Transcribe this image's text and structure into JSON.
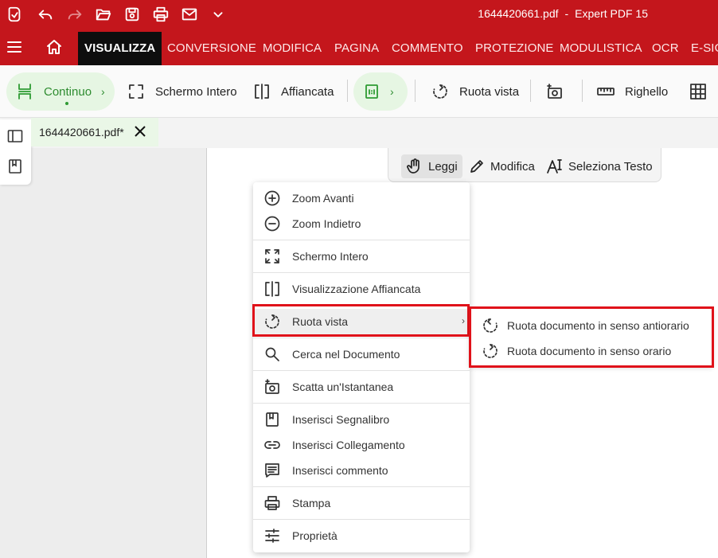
{
  "app": {
    "file_name": "1644420661.pdf",
    "separator": "-",
    "app_name": "Expert PDF 15"
  },
  "quick_access": [
    "app-logo-icon",
    "undo-icon",
    "redo-icon",
    "open-folder-icon",
    "save-icon",
    "print-icon",
    "mail-icon",
    "chevron-down-icon"
  ],
  "ribbon": {
    "tabs": [
      "VISUALIZZA",
      "CONVERSIONE",
      "MODIFICA",
      "PAGINA",
      "COMMENTO",
      "PROTEZIONE",
      "MODULISTICA",
      "OCR",
      "E-SIG"
    ]
  },
  "toolbar": {
    "continuo": "Continuo",
    "schermo_intero": "Schermo Intero",
    "affiancata": "Affiancata",
    "ruota_vista": "Ruota vista",
    "righello": "Righello",
    "chevron": "›"
  },
  "document_tab": {
    "name": "1644420661.pdf*"
  },
  "mode_bar": {
    "leggi": "Leggi",
    "modifica": "Modifica",
    "seleziona_testo": "Seleziona Testo"
  },
  "context_menu": {
    "zoom_avanti": "Zoom Avanti",
    "zoom_indietro": "Zoom Indietro",
    "schermo_intero": "Schermo Intero",
    "visualizzazione_affiancata": "Visualizzazione Affiancata",
    "ruota_vista": "Ruota vista",
    "cerca": "Cerca nel Documento",
    "istantanea": "Scatta un'Istantanea",
    "segnalibro": "Inserisci Segnalibro",
    "collegamento": "Inserisci Collegamento",
    "commento": "Inserisci commento",
    "stampa": "Stampa",
    "proprieta": "Proprietà",
    "submenu_arrow": "›"
  },
  "submenu": {
    "antiorario": "Ruota documento in senso antiorario",
    "orario": "Ruota documento in senso orario"
  },
  "colors": {
    "brand_red": "#c4161c",
    "accent_green": "#2e9b33",
    "highlight_red": "#e0121a"
  }
}
